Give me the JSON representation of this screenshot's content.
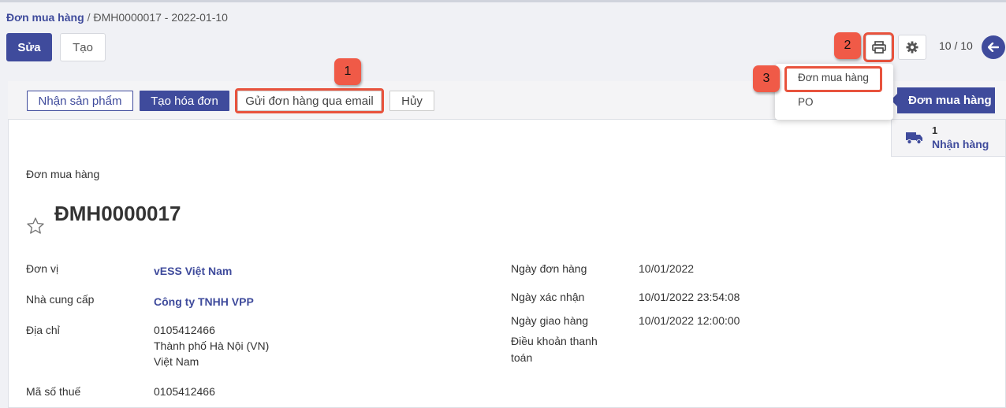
{
  "breadcrumb": {
    "parent": "Đơn mua hàng",
    "separator": "/",
    "current": "ĐMH0000017 - 2022-01-10"
  },
  "toolbar": {
    "edit_label": "Sửa",
    "create_label": "Tạo"
  },
  "pager": {
    "text": "10 / 10"
  },
  "callouts": {
    "c1": "1",
    "c2": "2",
    "c3": "3"
  },
  "print_menu": {
    "items": [
      "Đơn mua hàng",
      "PO"
    ]
  },
  "status_buttons": {
    "receive": "Nhận sản phẩm",
    "invoice": "Tạo hóa đơn",
    "email": "Gửi đơn hàng qua email",
    "cancel": "Hủy"
  },
  "stage": {
    "active": "Đơn mua hàng"
  },
  "smart_button": {
    "count": "1",
    "label": "Nhận hàng"
  },
  "form": {
    "doc_type": "Đơn mua hàng",
    "doc_number": "ĐMH0000017",
    "left": {
      "unit_label": "Đơn vị",
      "unit_value": "vESS Việt Nam",
      "supplier_label": "Nhà cung cấp",
      "supplier_value": "Công ty TNHH VPP",
      "address_label": "Địa chỉ",
      "address_lines": [
        "0105412466",
        "Thành phố Hà Nội (VN)",
        "Việt Nam"
      ],
      "tax_label": "Mã số thuế",
      "tax_value": "0105412466"
    },
    "right": {
      "order_date_label": "Ngày đơn hàng",
      "order_date_value": "10/01/2022",
      "confirm_date_label": "Ngày xác nhận",
      "confirm_date_value": "10/01/2022 23:54:08",
      "delivery_date_label": "Ngày giao hàng",
      "delivery_date_value": "10/01/2022 12:00:00",
      "payment_terms_label_1": "Điều khoản thanh",
      "payment_terms_label_2": "toán"
    }
  },
  "colors": {
    "primary": "#3f4b9c",
    "callout": "#f05a47",
    "highlight": "#e8533d"
  },
  "icons": {
    "print": "printer-icon",
    "settings": "gear-icon",
    "next": "arrow-left-icon",
    "favorite": "star-outline-icon",
    "delivery": "truck-icon"
  }
}
